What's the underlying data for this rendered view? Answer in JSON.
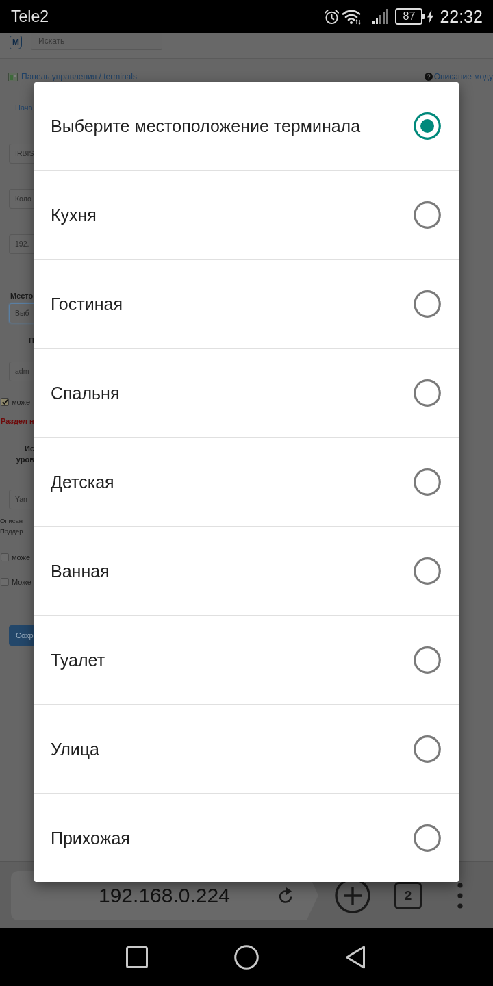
{
  "status_bar": {
    "carrier": "Tele2",
    "battery": "87",
    "time": "22:32"
  },
  "page": {
    "logo": "M",
    "search": {
      "placeholder": "Искать"
    },
    "breadcrumb": "Панель управления / terminals",
    "help_link": "Описание моду",
    "tab": "Нача",
    "form": [
      {
        "kind": "field",
        "value": "IRBIS",
        "focused": false
      },
      {
        "kind": "field",
        "value": "Коло",
        "focused": false
      },
      {
        "kind": "field",
        "value": "192.",
        "focused": false
      },
      {
        "kind": "label",
        "text": "Место"
      },
      {
        "kind": "field",
        "value": "Выб",
        "focused": true
      },
      {
        "kind": "heading",
        "lines": [
          "П"
        ]
      },
      {
        "kind": "field",
        "value": "adm",
        "focused": false
      },
      {
        "kind": "checkbox",
        "text": "може",
        "checked": true
      },
      {
        "kind": "error",
        "text": "Раздел н"
      },
      {
        "kind": "heading",
        "lines": [
          "Ис",
          "уров"
        ]
      },
      {
        "kind": "field",
        "value": "Yan",
        "focused": false
      },
      {
        "kind": "note",
        "lines": [
          "Описан",
          "Поддер"
        ]
      },
      {
        "kind": "checkbox",
        "text": "може",
        "checked": false
      },
      {
        "kind": "checkbox",
        "text": "Може",
        "checked": false
      },
      {
        "kind": "button",
        "text": "Сохр"
      }
    ]
  },
  "dialog": {
    "options": [
      {
        "label": "Выберите местоположение терминала",
        "selected": true
      },
      {
        "label": "Кухня",
        "selected": false
      },
      {
        "label": "Гостиная",
        "selected": false
      },
      {
        "label": "Спальня",
        "selected": false
      },
      {
        "label": "Детская",
        "selected": false
      },
      {
        "label": "Ванная",
        "selected": false
      },
      {
        "label": "Туалет",
        "selected": false
      },
      {
        "label": "Улица",
        "selected": false
      },
      {
        "label": "Прихожая",
        "selected": false
      }
    ]
  },
  "browser_bar": {
    "url": "192.168.0.224",
    "tab_count": "2"
  }
}
